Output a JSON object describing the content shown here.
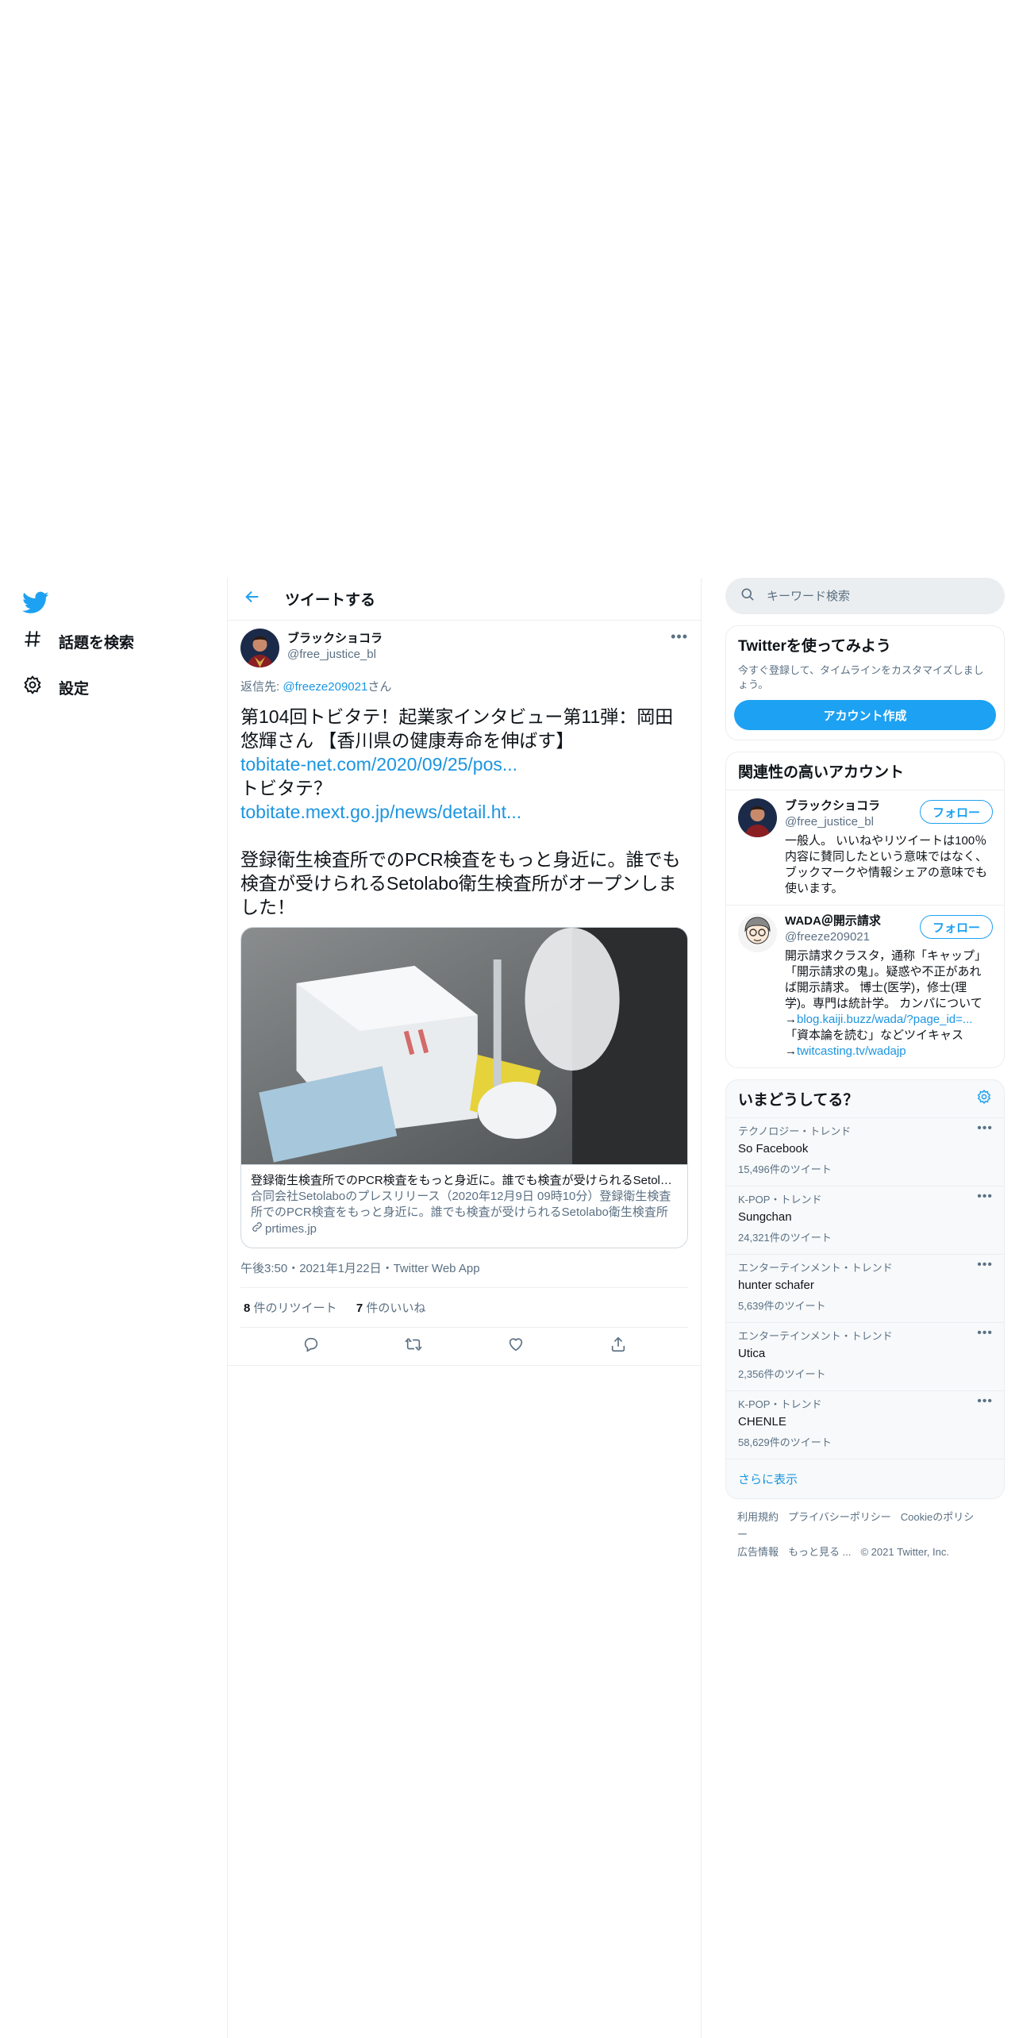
{
  "nav": {
    "items": [
      {
        "label": "話題を検索",
        "icon": "hashtag-icon"
      },
      {
        "label": "設定",
        "icon": "gear-icon"
      }
    ]
  },
  "header": {
    "title": "ツイートする"
  },
  "tweet": {
    "display_name": "ブラックショコラ",
    "handle": "@free_justice_bl",
    "reply_prefix": "返信先: ",
    "reply_handle": "@freeze209021",
    "reply_suffix": "さん",
    "text_1": "第104回トビタテ！起業家インタビュー第11弾：岡田悠輝さん 【香川県の健康寿命を伸ばす】",
    "link_1": "tobitate-net.com/2020/09/25/pos...",
    "text_2": "トビタテ？",
    "link_2": "tobitate.mext.go.jp/news/detail.ht...",
    "text_3": "登録衛生検査所でのPCR検査をもっと身近に。誰でも検査が受けられるSetolabo衛生検査所がオープンしました！",
    "card": {
      "title": "登録衛生検査所でのPCR検査をもっと身近に。誰でも検査が受けられるSetolabo衛生検査所がオープンしました！",
      "description": "合同会社Setolaboのプレスリリース（2020年12月9日 09時10分）登録衛生検査所でのPCR検査をもっと身近に。誰でも検査が受けられるSetolabo衛生検査所がオープンしました！",
      "domain": "prtimes.jp"
    },
    "meta": "午後3:50・2021年1月22日・Twitter Web App",
    "retweets": "8",
    "retweets_label": " 件のリツイート",
    "likes": "7",
    "likes_label": " 件のいいね"
  },
  "search": {
    "placeholder": "キーワード検索"
  },
  "signup": {
    "title": "Twitterを使ってみよう",
    "desc": "今すぐ登録して、タイムラインをカスタマイズしましょう。",
    "button": "アカウント作成"
  },
  "related": {
    "title": "関連性の高いアカウント",
    "follow_label": "フォロー",
    "accounts": [
      {
        "name": "ブラックショコラ",
        "handle": "@free_justice_bl",
        "bio": "一般人。 いいねやリツイートは100％内容に賛同したという意味ではなく、ブックマークや情報シェアの意味でも使います。"
      },
      {
        "name": "WADA＠開示請求",
        "handle": "@freeze209021",
        "bio": "開示請求クラスタ，通称「キャップ」「開示請求の鬼」。疑惑や不正があれば開示請求。 博士(医学)，修士(理学)。専門は統計学。 カンパについて→",
        "bio_link_1": "blog.kaiji.buzz/wada/?page_id=...",
        "bio_mid": "「資本論を読む」などツイキャス→",
        "bio_link_2": "twitcasting.tv/wadajp"
      }
    ]
  },
  "trends": {
    "title": "いまどうしてる？",
    "items": [
      {
        "context": "テクノロジー・トレンド",
        "name": "So Facebook",
        "count": "15,496件のツイート"
      },
      {
        "context": "K-POP・トレンド",
        "name": "Sungchan",
        "count": "24,321件のツイート"
      },
      {
        "context": "エンターテインメント・トレンド",
        "name": "hunter schafer",
        "count": "5,639件のツイート"
      },
      {
        "context": "エンターテインメント・トレンド",
        "name": "Utica",
        "count": "2,356件のツイート"
      },
      {
        "context": "K-POP・トレンド",
        "name": "CHENLE",
        "count": "58,629件のツイート"
      }
    ],
    "show_more": "さらに表示"
  },
  "footer": {
    "links": [
      "利用規約",
      "プライバシーポリシー",
      "Cookieのポリシー",
      "広告情報",
      "もっと見る ..."
    ],
    "copyright": "© 2021 Twitter, Inc."
  },
  "colors": {
    "accent": "#1da1f2",
    "link": "#1b95e0",
    "muted": "#5b7083",
    "border": "#ebeef0"
  }
}
